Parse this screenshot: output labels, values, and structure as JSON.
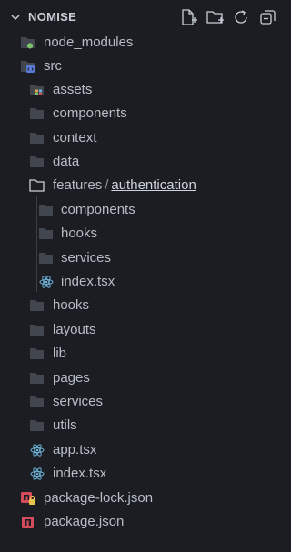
{
  "panel": {
    "title": "NOMISE"
  },
  "tree": {
    "node_modules": "node_modules",
    "src": "src",
    "assets": "assets",
    "components": "components",
    "context": "context",
    "data": "data",
    "features": "features",
    "features_sep": "/",
    "authentication": "authentication",
    "auth_components": "components",
    "auth_hooks": "hooks",
    "auth_services": "services",
    "auth_index": "index.tsx",
    "hooks": "hooks",
    "layouts": "layouts",
    "lib": "lib",
    "pages": "pages",
    "services": "services",
    "utils": "utils",
    "app": "app.tsx",
    "index": "index.tsx",
    "package_lock": "package-lock.json",
    "package": "package.json"
  },
  "icons": {
    "folder": "folder-icon",
    "open_folder": "open-folder-icon",
    "react_file": "react-file-icon",
    "npm_lock_file": "npm-lock-file-icon",
    "npm_file": "npm-file-icon"
  },
  "colors": {
    "background": "#1b1d23",
    "text": "#b7bdc7",
    "folder": "#41464f",
    "react": "#6fb3d8",
    "npm": "#d44b5b",
    "lock": "#e6c34a",
    "node_badge": "#7cc36b",
    "src_badge": "#5b7bd6"
  }
}
